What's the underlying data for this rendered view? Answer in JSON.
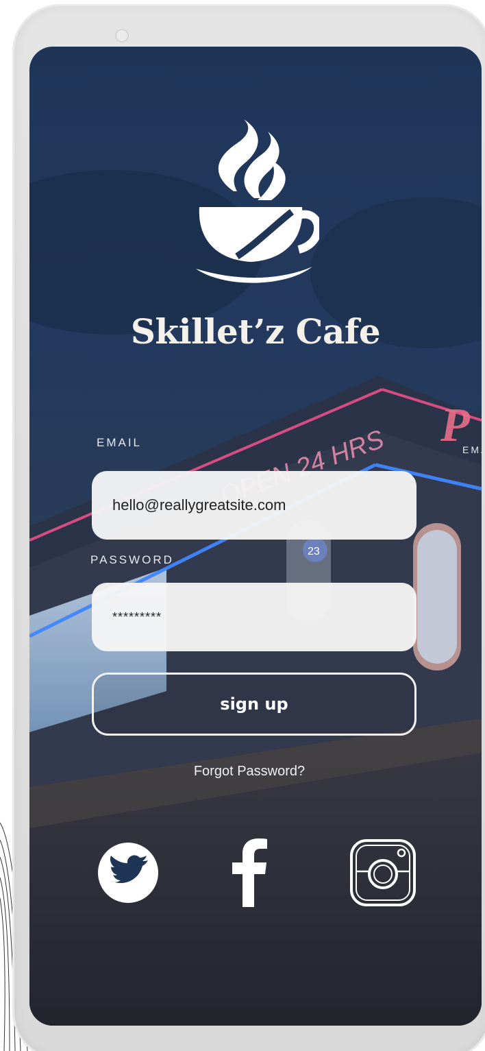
{
  "brand": {
    "name": "Skillet’z Cafe",
    "logo_icon": "coffee-cup-icon"
  },
  "background": {
    "sign_text": "OPEN 24 HRS",
    "sign_letter": "P",
    "badge_text": "23"
  },
  "form": {
    "email_label": "EMAIL",
    "email_value": "hello@reallygreatsite.com",
    "password_label": "PASSWORD",
    "password_value": "*********",
    "edge_label": "EMA",
    "submit_label": "sign up",
    "forgot_label": "Forgot Password?"
  },
  "social": {
    "items": [
      {
        "icon": "twitter-icon"
      },
      {
        "icon": "facebook-icon"
      },
      {
        "icon": "instagram-icon"
      }
    ]
  },
  "colors": {
    "screen_top": "#1e3558",
    "neon_pink": "#e8508a",
    "neon_blue": "#3f86ff",
    "text_light": "#f4f1ea"
  }
}
